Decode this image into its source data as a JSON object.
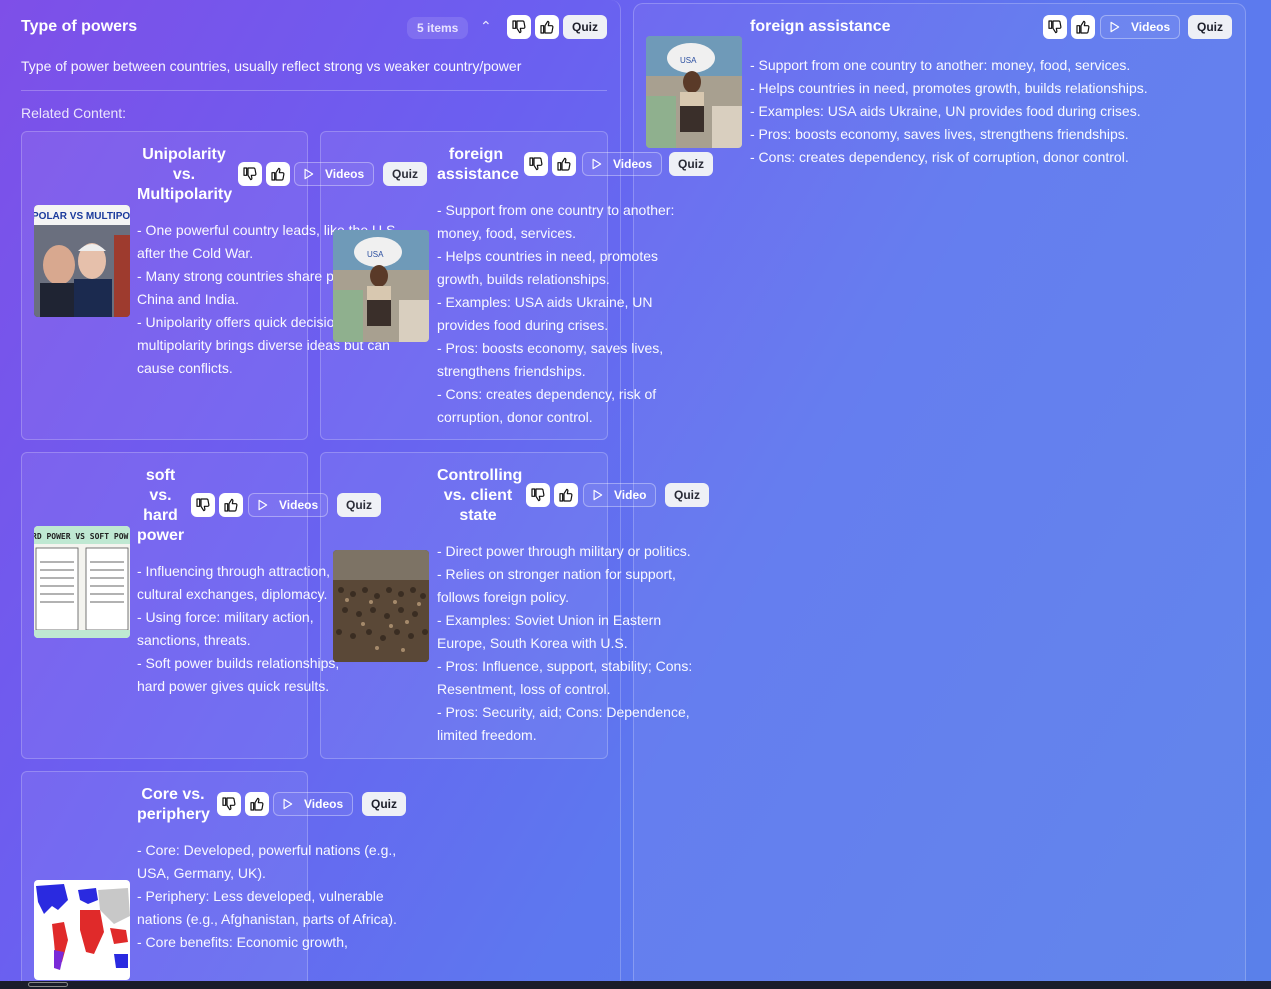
{
  "main": {
    "title": "Type of powers",
    "count": "5 items",
    "description": "Type of power between countries, usually reflect strong vs weaker country/power",
    "related_label": "Related Content:",
    "quiz_label": "Quiz"
  },
  "cards": [
    {
      "title": "Unipolarity vs. Multipolarity",
      "video_label": "Videos",
      "quiz_label": "Quiz",
      "image_icon": "unipolar-vs-multipolar-thumbnail",
      "image_text": "POLAR VS MULTIPOL",
      "lines": [
        "- One powerful country leads, like the U.S. after the Cold War.",
        "- Many strong countries share power, like China and India.",
        "- Unipolarity offers quick decisions; multipolarity brings diverse ideas but can cause conflicts."
      ]
    },
    {
      "title": "foreign assistance",
      "video_label": "Videos",
      "quiz_label": "Quiz",
      "image_icon": "food-aid-thumbnail",
      "lines": [
        "- Support from one country to another: money, food, services.",
        "- Helps countries in need, promotes growth, builds relationships.",
        "- Examples: USA aids Ukraine, UN provides food during crises.",
        "- Pros: boosts economy, saves lives, strengthens friendships.",
        "- Cons: creates dependency, risk of corruption, donor control."
      ]
    },
    {
      "title": "soft vs. hard power",
      "video_label": "Videos",
      "quiz_label": "Quiz",
      "image_icon": "hard-vs-soft-power-thumbnail",
      "image_text": "RD POWER VS SOFT POW",
      "lines": [
        "- Influencing through attraction, cultural exchanges, diplomacy.",
        "- Using force: military action, sanctions, threats.",
        "- Soft power builds relationships; hard power gives quick results."
      ]
    },
    {
      "title": "Controlling vs. client state",
      "video_label": "Video",
      "quiz_label": "Quiz",
      "image_icon": "army-crowd-thumbnail",
      "lines": [
        "- Direct power through military or politics.",
        "- Relies on stronger nation for support, follows foreign policy.",
        "- Examples: Soviet Union in Eastern Europe, South Korea with U.S.",
        "- Pros: Influence, support, stability; Cons: Resentment, loss of control.",
        "- Pros: Security, aid; Cons: Dependence, limited freedom."
      ]
    },
    {
      "title": "Core vs. periphery",
      "video_label": "Videos",
      "quiz_label": "Quiz",
      "image_icon": "world-map-thumbnail",
      "lines": [
        "- Core: Developed, powerful nations (e.g., USA, Germany, UK).",
        "- Periphery: Less developed, vulnerable nations (e.g., Afghanistan, parts of Africa).",
        "- Core benefits: Economic growth,"
      ]
    }
  ],
  "detail": {
    "title": "foreign assistance",
    "video_label": "Videos",
    "quiz_label": "Quiz",
    "image_icon": "food-aid-thumbnail",
    "lines": [
      "- Support from one country to another: money, food, services.",
      "- Helps countries in need, promotes growth, builds relationships.",
      "- Examples: USA aids Ukraine, UN provides food during crises.",
      "- Pros: boosts economy, saves lives, strengthens friendships.",
      "- Cons: creates dependency, risk of corruption, donor control."
    ]
  }
}
